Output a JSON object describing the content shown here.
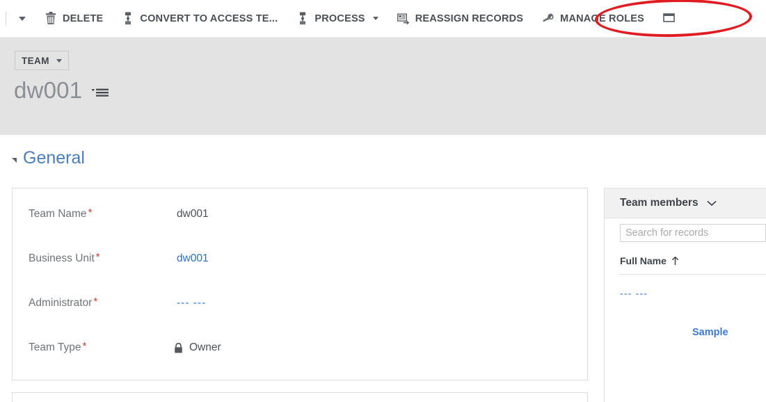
{
  "command_bar": {
    "overflow_caret_icon": "chevron-down-icon",
    "buttons": [
      {
        "label": "DELETE",
        "icon": "trash-icon",
        "has_dropdown": false
      },
      {
        "label": "CONVERT TO ACCESS TE...",
        "icon": "team-convert-icon",
        "has_dropdown": false
      },
      {
        "label": "PROCESS",
        "icon": "process-icon",
        "has_dropdown": true
      },
      {
        "label": "REASSIGN RECORDS",
        "icon": "reassign-records-icon",
        "has_dropdown": false
      },
      {
        "label": "MANAGE ROLES",
        "icon": "wrench-icon",
        "has_dropdown": false
      }
    ],
    "annotation": {
      "shape": "ellipse",
      "color": "#e01b22",
      "targets": "MANAGE ROLES"
    }
  },
  "record_header": {
    "entity_chip_label": "TEAM",
    "entity_chip_icon": "chevron-down-icon",
    "title": "dw001",
    "title_menu_icon": "record-menu-icon"
  },
  "form": {
    "section": {
      "label": "General",
      "collapse_icon": "triangle-collapse-icon",
      "color": "#4a7ebb"
    },
    "fields": [
      {
        "label": "Team Name",
        "required": true,
        "value": "dw001",
        "style": "text"
      },
      {
        "label": "Business Unit",
        "required": true,
        "value": "dw001",
        "style": "link"
      },
      {
        "label": "Administrator",
        "required": true,
        "value": "--- ---",
        "style": "dashes"
      },
      {
        "label": "Team Type",
        "required": true,
        "value": "Owner",
        "style": "locked",
        "icon": "lock-icon"
      }
    ]
  },
  "side_panel": {
    "title": "Team members",
    "title_icon": "chevron-down-icon",
    "search": {
      "placeholder": "Search for records",
      "value": ""
    },
    "grid": {
      "columns": [
        {
          "label": "Full Name",
          "sort_icon": "sort-ascending-arrow",
          "sort": "asc"
        }
      ],
      "rows": [
        {
          "full_name": "--- ---",
          "style": "dashes"
        },
        {
          "full_name": "Sample",
          "style": "sample"
        }
      ]
    }
  }
}
